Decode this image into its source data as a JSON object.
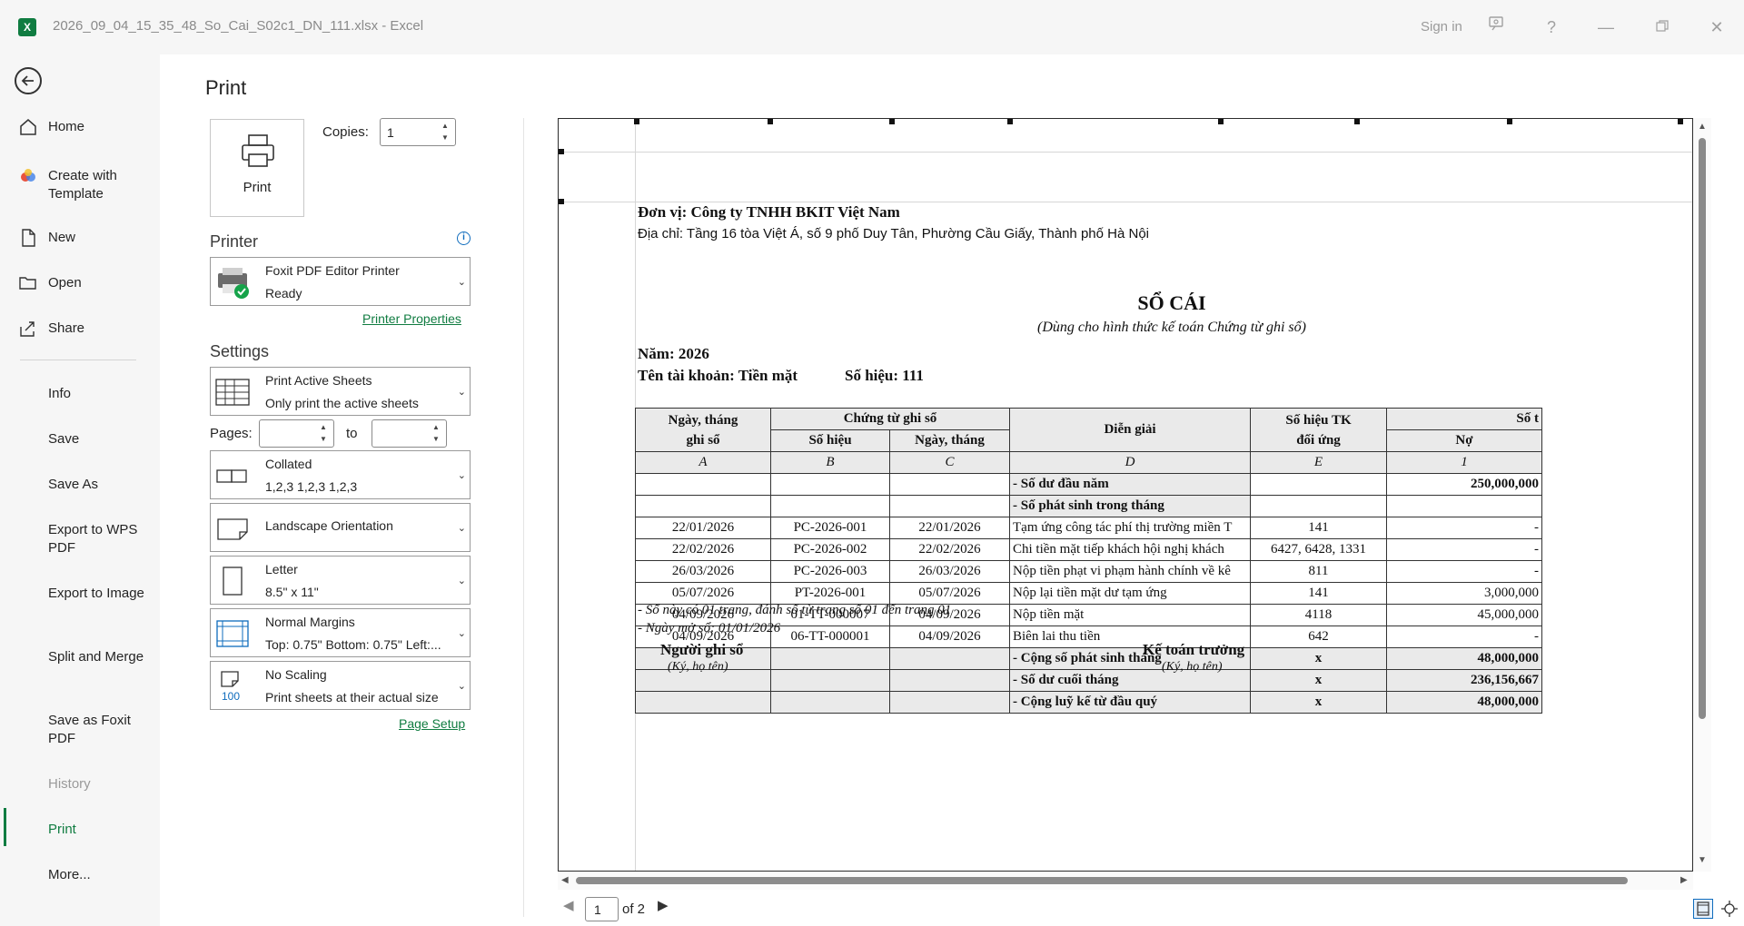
{
  "window": {
    "title": "2026_09_04_15_35_48_So_Cai_S02c1_DN_111.xlsx  -  Excel",
    "app_icon": "X",
    "sign_in": "Sign in"
  },
  "nav": {
    "items": [
      {
        "label": "Home",
        "icon": "home-icon"
      },
      {
        "label": "Create with Template",
        "icon": "template-icon"
      },
      {
        "label": "New",
        "icon": "new-file-icon"
      },
      {
        "label": "Open",
        "icon": "open-folder-icon"
      },
      {
        "label": "Share",
        "icon": "share-icon"
      }
    ],
    "plain_items": [
      "Info",
      "Save",
      "Save As",
      "Export to WPS PDF",
      "Export to Image",
      "Split and Merge",
      "Save as Foxit PDF",
      "History",
      "Print",
      "More..."
    ],
    "active": "Print"
  },
  "print": {
    "heading": "Print",
    "print_button": "Print",
    "copies_label": "Copies:",
    "copies_value": "1",
    "printer_heading": "Printer",
    "printer_name": "Foxit PDF Editor Printer",
    "printer_status": "Ready",
    "printer_properties": "Printer Properties",
    "settings_heading": "Settings",
    "sheets_title": "Print Active Sheets",
    "sheets_desc": "Only print the active sheets",
    "pages_label": "Pages:",
    "to_label": "to",
    "collate_title": "Collated",
    "collate_desc": "1,2,3    1,2,3    1,2,3",
    "orientation": "Landscape Orientation",
    "paper_title": "Letter",
    "paper_desc": "8.5\" x 11\"",
    "margins_title": "Normal Margins",
    "margins_desc": "Top: 0.75\" Bottom: 0.75\" Left:...",
    "scaling_title": "No Scaling",
    "scaling_desc": "Print sheets at their actual size",
    "scaling_icon_text": "100",
    "page_setup": "Page Setup"
  },
  "doc": {
    "unit": "Đơn vị: Công ty TNHH BKIT Việt Nam",
    "address": "Địa chỉ: Tầng 16 tòa Việt Á, số 9 phố Duy Tân, Phường Cầu Giấy, Thành phố Hà Nội",
    "title": "SỔ CÁI",
    "subtitle": "(Dùng cho hình thức kế toán Chứng từ ghi sổ)",
    "year": "Năm: 2026",
    "account_name": "Tên tài khoản: Tiền mặt",
    "account_no": "Số hiệu: 111",
    "headers": {
      "date_1": "Ngày, tháng",
      "date_2": "ghi sổ",
      "voucher": "Chứng từ ghi sổ",
      "voucher_no": "Số hiệu",
      "voucher_date": "Ngày, tháng",
      "desc": "Diễn giải",
      "acct_1": "Số hiệu TK",
      "acct_2": "đối ứng",
      "amount": "Số t",
      "debit": "Nợ"
    },
    "subheaders": [
      "A",
      "B",
      "C",
      "D",
      "E",
      "1"
    ],
    "rows": [
      {
        "date": "",
        "no": "",
        "vdate": "",
        "desc": "- Số dư đầu năm",
        "acct": "",
        "amt": "250,000,000",
        "style": "gray-bold"
      },
      {
        "date": "",
        "no": "",
        "vdate": "",
        "desc": "- Số phát sinh trong tháng",
        "acct": "",
        "amt": "",
        "style": "gray-bold"
      },
      {
        "date": "22/01/2026",
        "no": "PC-2026-001",
        "vdate": "22/01/2026",
        "desc": "Tạm ứng công tác phí thị trường miền T",
        "acct": "141",
        "amt": "-",
        "style": ""
      },
      {
        "date": "22/02/2026",
        "no": "PC-2026-002",
        "vdate": "22/02/2026",
        "desc": "Chi tiền mặt tiếp khách hội nghị khách",
        "acct": "6427, 6428, 1331",
        "amt": "-",
        "style": ""
      },
      {
        "date": "26/03/2026",
        "no": "PC-2026-003",
        "vdate": "26/03/2026",
        "desc": "Nộp tiền phạt vi phạm hành chính về kê",
        "acct": "811",
        "amt": "-",
        "style": ""
      },
      {
        "date": "05/07/2026",
        "no": "PT-2026-001",
        "vdate": "05/07/2026",
        "desc": "Nộp lại tiền mặt dư tạm ứng",
        "acct": "141",
        "amt": "3,000,000",
        "style": ""
      },
      {
        "date": "04/09/2026",
        "no": "01-TT-000007",
        "vdate": "04/09/2026",
        "desc": "Nộp tiền mặt",
        "acct": "4118",
        "amt": "45,000,000",
        "style": ""
      },
      {
        "date": "04/09/2026",
        "no": "06-TT-000001",
        "vdate": "04/09/2026",
        "desc": "Biên lai thu tiền",
        "acct": "642",
        "amt": "-",
        "style": ""
      },
      {
        "date": "",
        "no": "",
        "vdate": "",
        "desc": "- Cộng số phát sinh tháng",
        "acct": "x",
        "amt": "48,000,000",
        "style": "gray-bold-all"
      },
      {
        "date": "",
        "no": "",
        "vdate": "",
        "desc": "- Số dư cuối tháng",
        "acct": "x",
        "amt": "236,156,667",
        "style": "gray-bold-all"
      },
      {
        "date": "",
        "no": "",
        "vdate": "",
        "desc": "- Cộng luỹ kế từ đầu quý",
        "acct": "x",
        "amt": "48,000,000",
        "style": "gray-bold-all"
      }
    ],
    "note_1": "- Sổ này có 01 trang, đánh số từ trang số 01 đến trang 01",
    "note_2": "- Ngày mở sổ: 01/01/2026",
    "sign_left": "Người ghi sổ",
    "sign_left_sub": "(Ký, họ tên)",
    "sign_right": "Kế toán trưởng",
    "sign_right_sub": "(Ký, họ tên)"
  },
  "pager": {
    "current": "1",
    "of": "of 2"
  },
  "colors": {
    "accent": "#107c41",
    "link": "#107c41",
    "info": "#0f6cbd"
  }
}
